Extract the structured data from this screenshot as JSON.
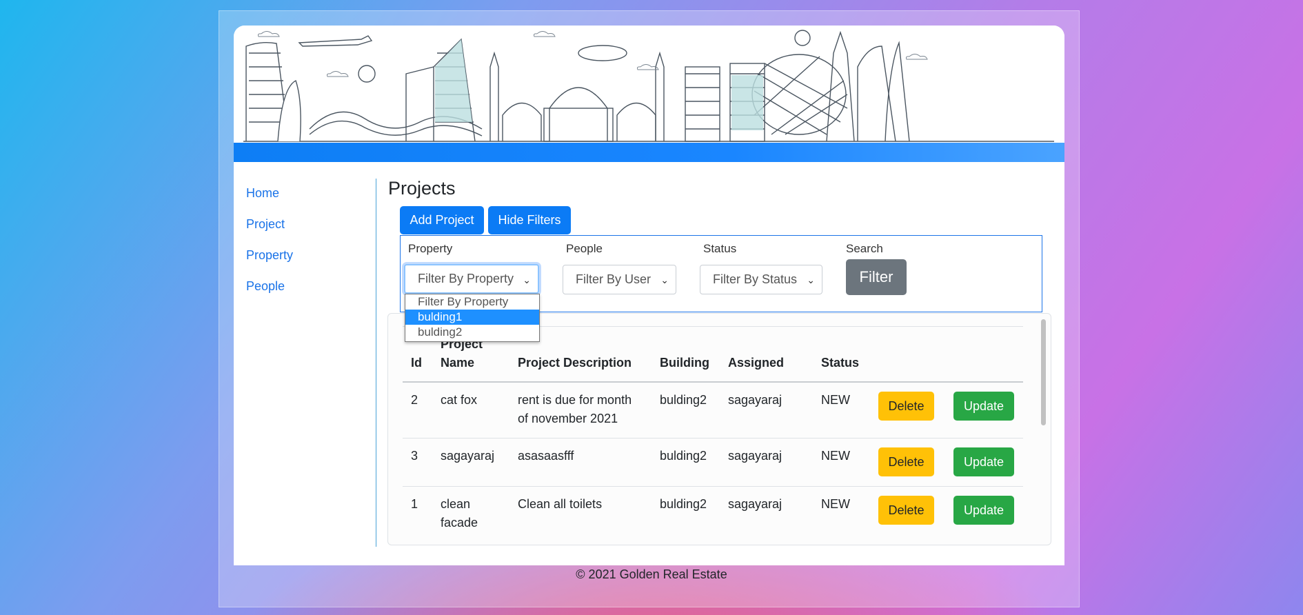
{
  "sidebar": {
    "items": [
      "Home",
      "Project",
      "Property",
      "People"
    ]
  },
  "page": {
    "title": "Projects"
  },
  "toolbar": {
    "add_project": "Add Project",
    "hide_filters": "Hide Filters"
  },
  "filters": {
    "property_label": "Property",
    "people_label": "People",
    "status_label": "Status",
    "search_label": "Search",
    "property_value": "Filter By Property",
    "people_value": "Filter By User",
    "status_value": "Filter By Status",
    "filter_button": "Filter",
    "property_options": [
      "Filter By Property",
      "bulding1",
      "bulding2"
    ],
    "property_highlighted": "bulding1"
  },
  "table": {
    "headers": [
      "Id",
      "Project Name",
      "Project Description",
      "Building",
      "Assigned",
      "Status"
    ],
    "header_project_name_line1": "Project",
    "header_project_name_line2": "Name",
    "rows": [
      {
        "id": "2",
        "name_l1": "cat fox",
        "name_l2": "",
        "desc_l1": "rent is due for month",
        "desc_l2": "of november 2021",
        "building": "bulding2",
        "assigned": "sagayaraj",
        "status": "NEW"
      },
      {
        "id": "3",
        "name_l1": "sagayaraj",
        "name_l2": "",
        "desc_l1": "asasaasfff",
        "desc_l2": "",
        "building": "bulding2",
        "assigned": "sagayaraj",
        "status": "NEW"
      },
      {
        "id": "1",
        "name_l1": "clean",
        "name_l2": "facade",
        "desc_l1": "Clean all toilets",
        "desc_l2": "",
        "building": "bulding2",
        "assigned": "sagayaraj",
        "status": "NEW"
      }
    ],
    "delete_label": "Delete",
    "update_label": "Update"
  },
  "footer": {
    "text": "© 2021 Golden Real Estate"
  },
  "colors": {
    "primary": "#0b7bf5",
    "warning": "#ffc107",
    "success": "#28a745",
    "secondary": "#6c757d"
  }
}
